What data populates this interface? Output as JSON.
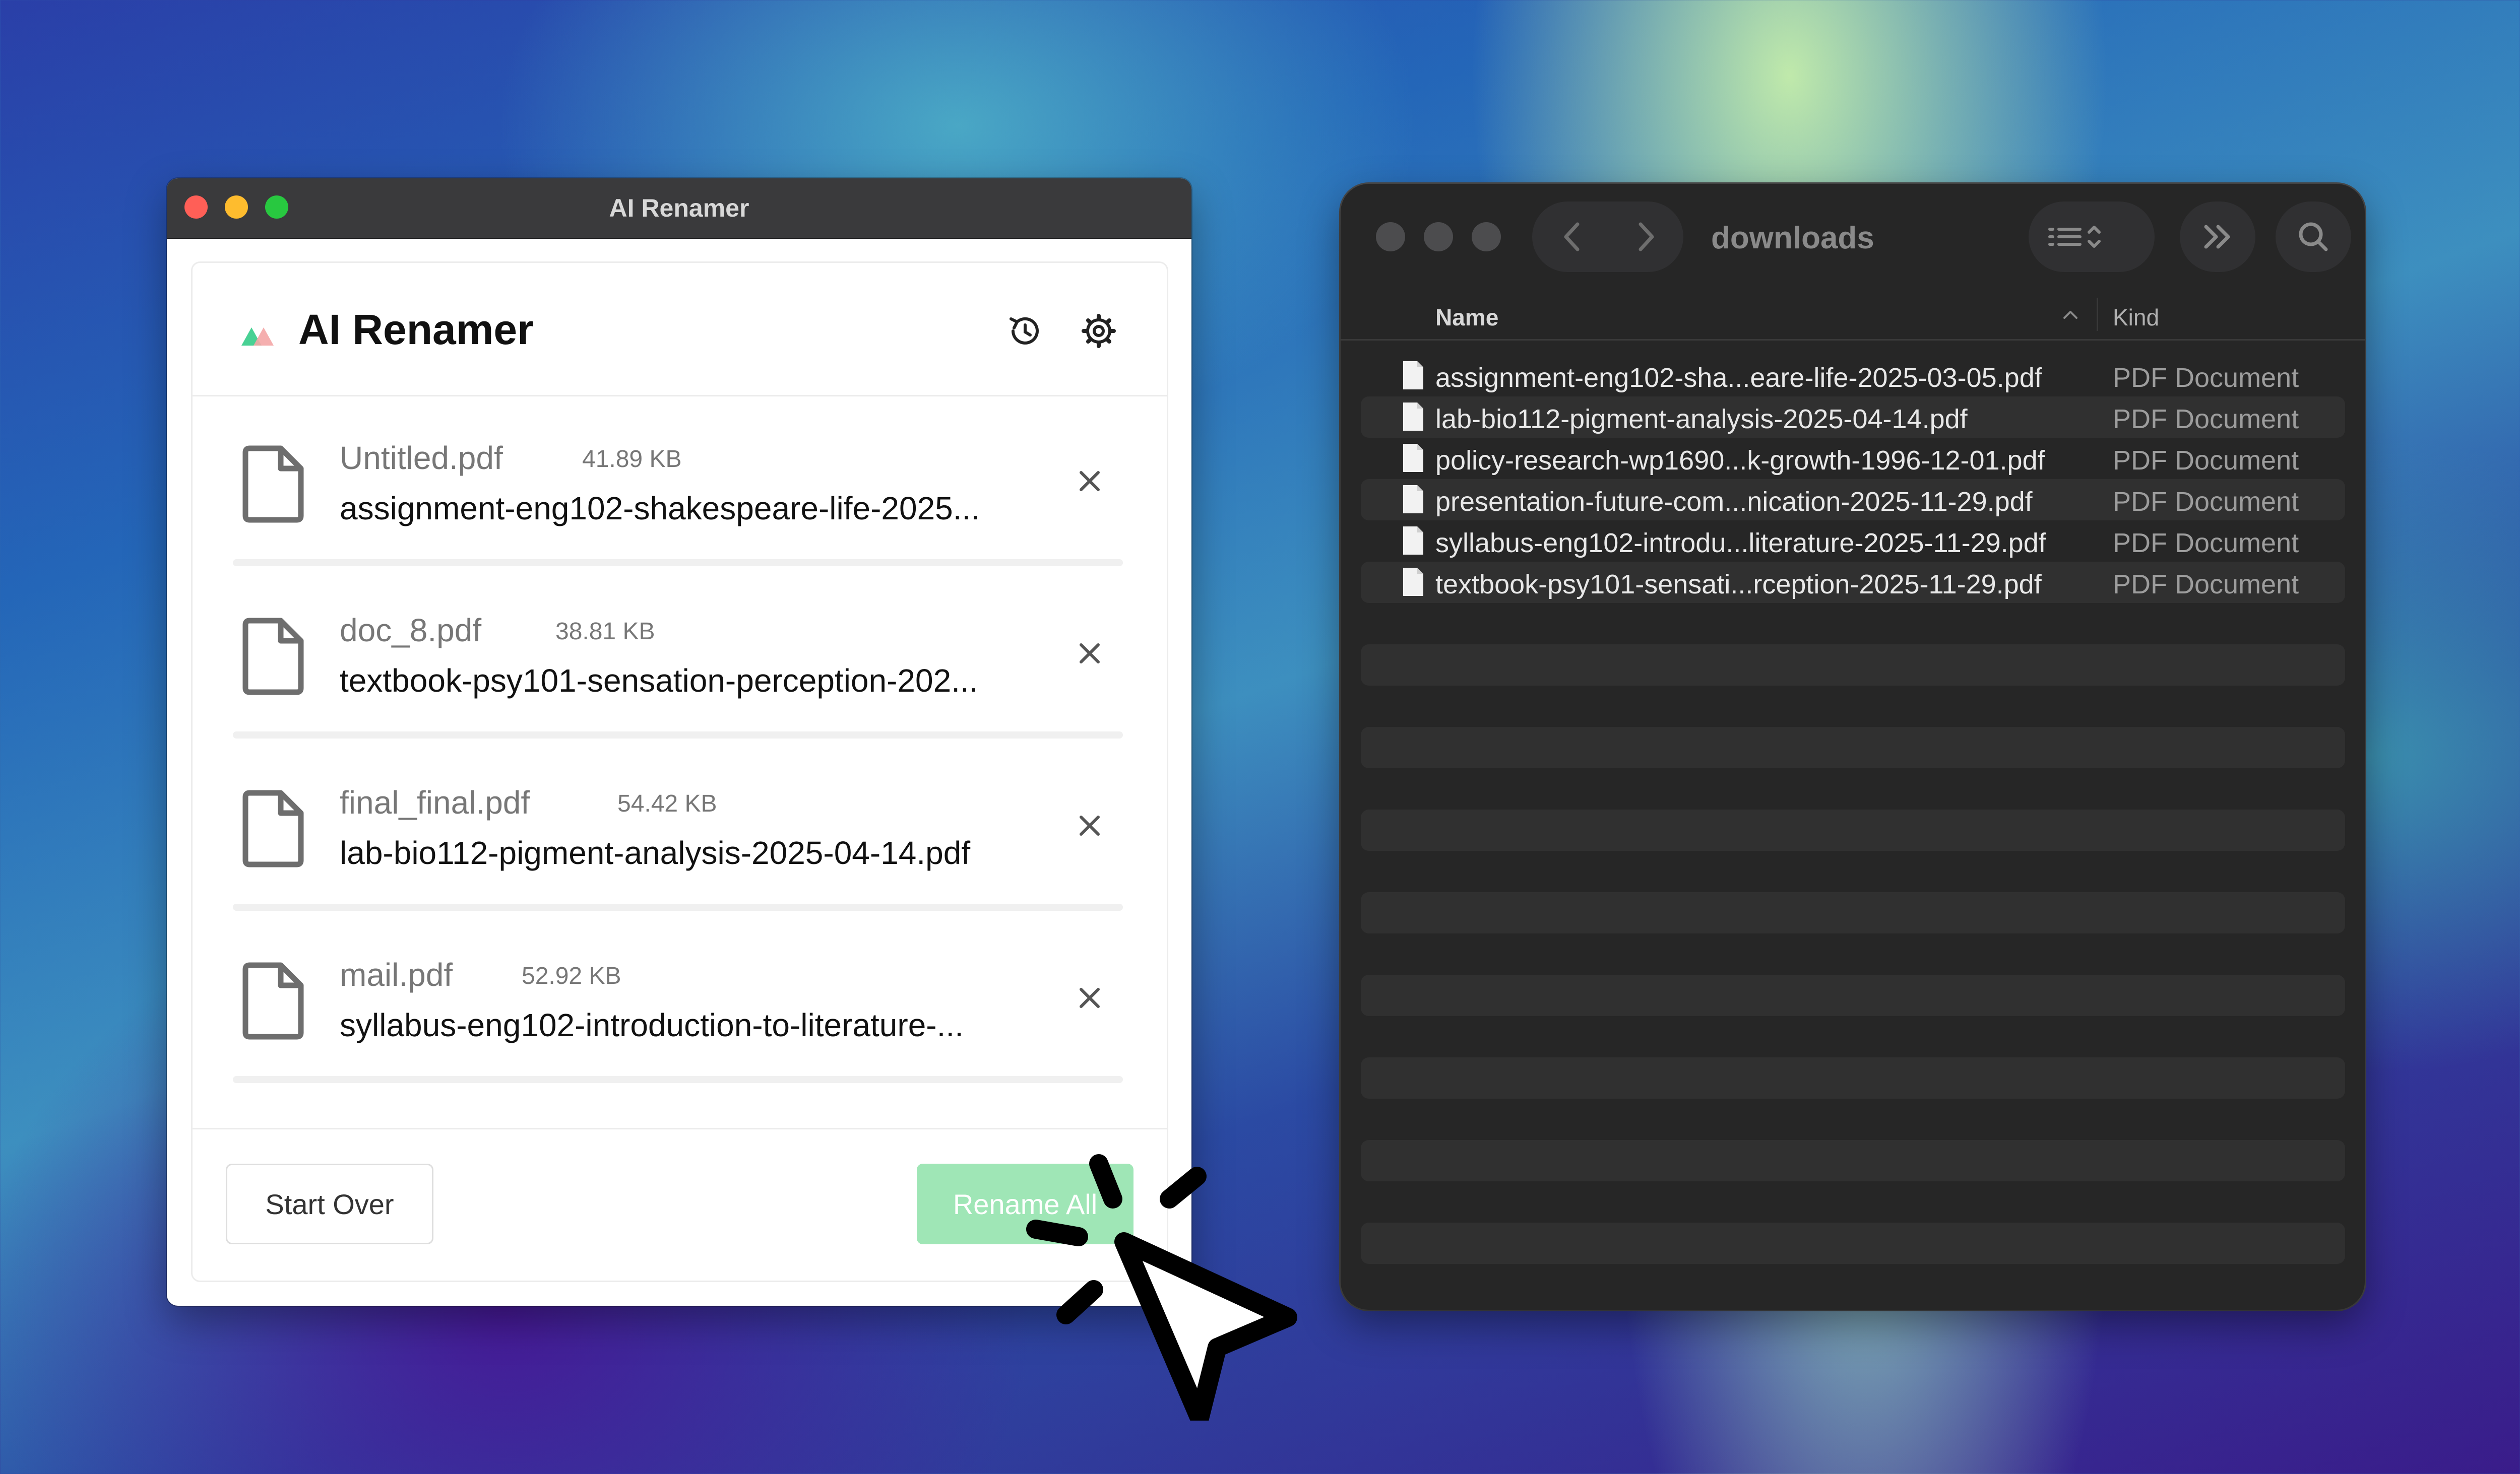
{
  "renamer": {
    "window_title": "AI Renamer",
    "app_title": "AI Renamer",
    "files": [
      {
        "original": "Untitled.pdf",
        "size": "41.89 KB",
        "new_name": "assignment-eng102-shakespeare-life-2025..."
      },
      {
        "original": "doc_8.pdf",
        "size": "38.81 KB",
        "new_name": "textbook-psy101-sensation-perception-202..."
      },
      {
        "original": "final_final.pdf",
        "size": "54.42 KB",
        "new_name": "lab-bio112-pigment-analysis-2025-04-14.pdf"
      },
      {
        "original": "mail.pdf",
        "size": "52.92 KB",
        "new_name": "syllabus-eng102-introduction-to-literature-..."
      }
    ],
    "start_over_label": "Start Over",
    "rename_all_label": "Rename All",
    "accent_color": "#9fe6b6"
  },
  "finder": {
    "folder_title": "downloads",
    "columns": {
      "name": "Name",
      "kind": "Kind"
    },
    "rows": [
      {
        "name": "assignment-eng102-sha...eare-life-2025-03-05.pdf",
        "kind": "PDF Document"
      },
      {
        "name": "lab-bio112-pigment-analysis-2025-04-14.pdf",
        "kind": "PDF Document"
      },
      {
        "name": "policy-research-wp1690...k-growth-1996-12-01.pdf",
        "kind": "PDF Document"
      },
      {
        "name": "presentation-future-com...nication-2025-11-29.pdf",
        "kind": "PDF Document"
      },
      {
        "name": "syllabus-eng102-introdu...literature-2025-11-29.pdf",
        "kind": "PDF Document"
      },
      {
        "name": "textbook-psy101-sensati...rception-2025-11-29.pdf",
        "kind": "PDF Document"
      }
    ]
  }
}
